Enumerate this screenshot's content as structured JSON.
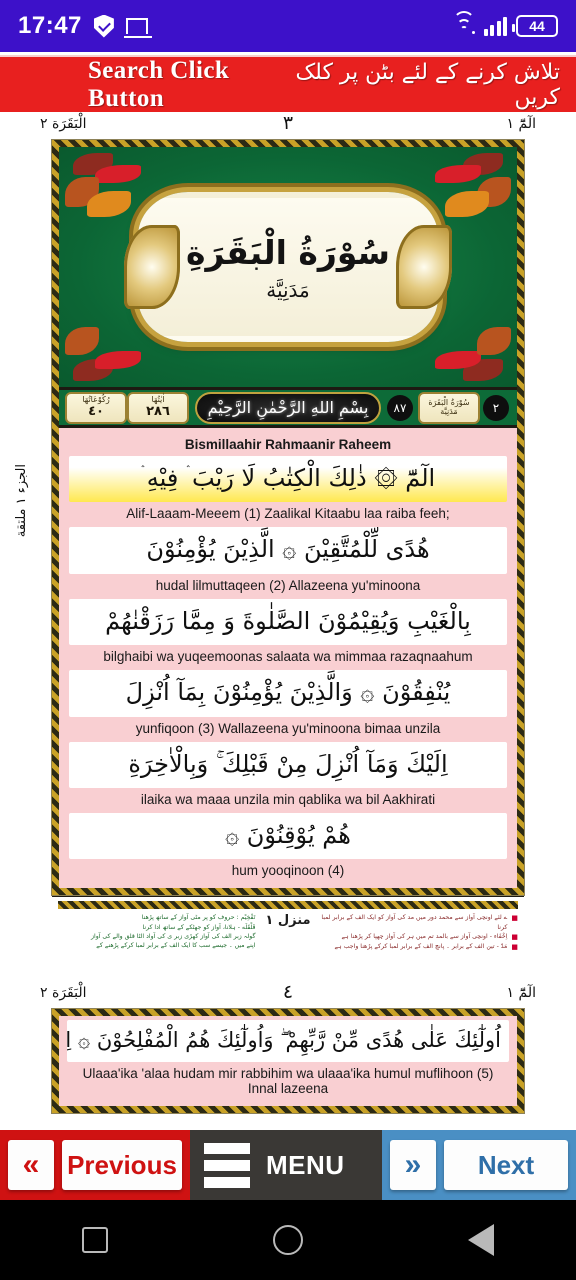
{
  "status_bar": {
    "time": "17:47",
    "icons": [
      "shield-icon",
      "cast-icon",
      "wifi-icon",
      "signal-icon"
    ],
    "battery_level": "44"
  },
  "search_banner": {
    "english_label": "Search Click Button",
    "urdu_label": "تلاش کرنے کے لئے بٹن پر کلک کریں",
    "background_color": "#e8201f"
  },
  "page": {
    "header": {
      "right_label": "الٓمّٓ ١",
      "page_number": "٣",
      "left_label": "الْبَقَرَة ٢"
    },
    "side_marker": "الجزء ١ ملتقة",
    "surah": {
      "title": "سُوْرَةُ الْبَقَرَةِ",
      "revelation_type": "مَدَنِيَّة"
    },
    "info_strip": {
      "ruku_label": "رُکُوْعَاتُهَا",
      "ruku_count": "٤٠",
      "ayat_label": "اٰیٰتُهَا",
      "ayat_count": "٢٨٦",
      "bismillah": "بِسْمِ اللهِ الرَّحْمٰنِ الرَّحِيْمِ",
      "surah_name": "سُوْرَةُ الْبَقَرَة",
      "surah_type": "مَدَنِيَّة",
      "order_number": "٨٧",
      "surah_number": "٢"
    },
    "bismillah_translit": "Bismillaahir Rahmaanir Raheem",
    "lines": [
      {
        "arabic": "الٓمّٓ ۞ ذٰلِكَ الْكِتٰبُ لَا رَيْبَ ۛ فِيْهِ ۛ",
        "translit": "Alif-Laaam-Meeem (1) Zaalikal Kitaabu laa raiba feeh;",
        "highlight": true
      },
      {
        "arabic": "هُدًى لِّلْمُتَّقِيْنَ ۞ الَّذِيْنَ يُؤْمِنُوْنَ",
        "translit": "hudal lilmuttaqeen (2) Allazeena yu'minoona",
        "highlight": false
      },
      {
        "arabic": "بِالْغَيْبِ وَيُقِيْمُوْنَ الصَّلٰوةَ وَ مِمَّا رَزَقْنٰهُمْ",
        "translit": "bilghaibi wa yuqeemoonas salaata wa mimmaa razaqnaahum",
        "highlight": false
      },
      {
        "arabic": "يُنْفِقُوْنَ ۞ وَالَّذِيْنَ يُؤْمِنُوْنَ بِمَآ اُنْزِلَ",
        "translit": "yunfiqoon (3) Wallazeena yu'minoona bimaa unzila",
        "highlight": false
      },
      {
        "arabic": "اِلَيْكَ وَمَآ اُنْزِلَ مِنْ قَبْلِكَ ۚ وَبِالْاٰخِرَةِ",
        "translit": "ilaika wa maaa unzila min qablika wa bil Aakhirati",
        "highlight": false
      },
      {
        "arabic": "هُمْ يُوْقِنُوْنَ ۞",
        "translit": "hum yooqinoon (4)",
        "highlight": false
      }
    ],
    "footnotes": {
      "center": "منزل ١",
      "right_lines": [
        "ے لئے اونچی آواز سے محمد دور میں مد کی آواز کو ایک الف کے برابر لمبا کرنا",
        "اِخْفَاء - اونچی آواز سے بالمد تم میں ہر کی آواز چھپا کر پڑھنا ہے",
        "مَدّ - تین الف کے برابر ۔ پانچ الف کے برابر لمبا کرکے پڑھنا واجب ہے"
      ],
      "left_lines": [
        "قَلْقَلَه - ہلانا، آواز کو جھٹکے کے ساتھ ادا کرنا",
        "گولہ زبر الف کی آواز کھڑی زبر ی کی آواد الٹا قلق والے کی آواز",
        "اپنے میں ۔ جیسے سب کا ایک الف کے برابر لمبا کرکے پڑھنے کے"
      ],
      "green_label": "تَفْخِيْم : حروف کو پر مٹی آواز کے ساتھ پڑھنا"
    }
  },
  "next_page": {
    "header": {
      "right_label": "الٓمّٓ ١",
      "page_number": "٤",
      "left_label": "الْبَقَرَة ٢"
    },
    "line_arabic": "اُولٰٓئِكَ عَلٰى هُدًى مِّنْ رَّبِّهِمْ ۖ وَاُولٰٓئِكَ هُمُ الْمُفْلِحُوْنَ ۞ اِنَّ الَّذِيْنَ",
    "line_translit": "Ulaaa'ika 'alaa hudam mir rabbihim wa ulaaa'ika humul muflihoon (5) Innal lazeena"
  },
  "bottom_nav": {
    "previous_label": "Previous",
    "previous_icon": "double-chevron-left-icon",
    "menu_label": "MENU",
    "menu_icon": "hamburger-icon",
    "next_label": "Next",
    "next_icon": "double-chevron-right-icon",
    "previous_color": "#cf1212",
    "menu_color": "#3a3835",
    "next_color": "#4a8fc4"
  },
  "android_nav": {
    "recents": "square-icon",
    "home": "circle-icon",
    "back": "triangle-back-icon"
  }
}
